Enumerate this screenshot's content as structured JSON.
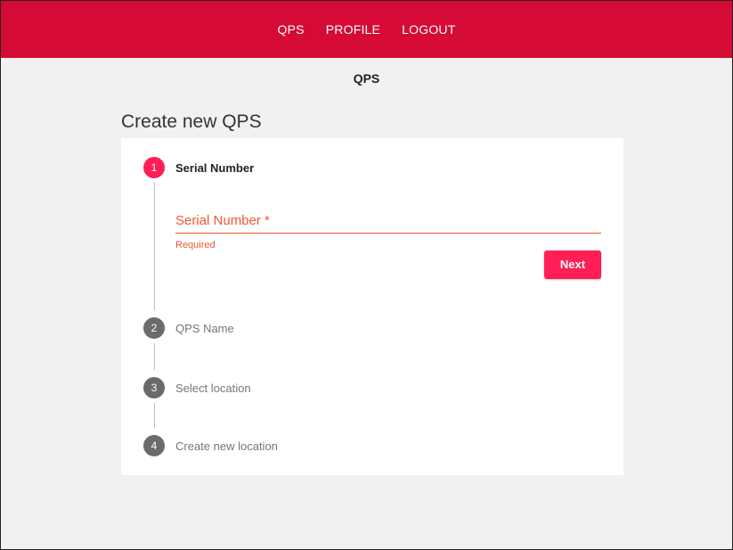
{
  "nav": {
    "items": [
      {
        "label": "QPS"
      },
      {
        "label": "PROFILE"
      },
      {
        "label": "LOGOUT"
      }
    ]
  },
  "subtitle": "QPS",
  "page": {
    "heading": "Create new QPS"
  },
  "stepper": {
    "steps": [
      {
        "number": "1",
        "label": "Serial Number",
        "state": "active"
      },
      {
        "number": "2",
        "label": "QPS Name",
        "state": "inactive"
      },
      {
        "number": "3",
        "label": "Select location",
        "state": "inactive"
      },
      {
        "number": "4",
        "label": "Create new location",
        "state": "inactive"
      }
    ],
    "active_field": {
      "label": "Serial Number *",
      "value": "",
      "error": "Required"
    },
    "next_label": "Next"
  },
  "colors": {
    "brand": "#d50b35",
    "accent": "#ff1e55",
    "error": "#ef5830",
    "inactive_step": "#6b6b6b"
  }
}
